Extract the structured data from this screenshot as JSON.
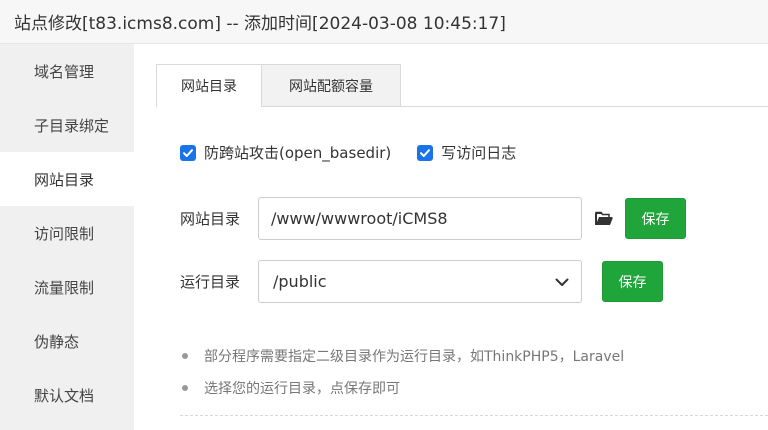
{
  "window": {
    "title": "站点修改[t83.icms8.com] -- 添加时间[2024-03-08 10:45:17]"
  },
  "sidebar": {
    "items": [
      {
        "label": "域名管理"
      },
      {
        "label": "子目录绑定"
      },
      {
        "label": "网站目录",
        "active": true
      },
      {
        "label": "访问限制"
      },
      {
        "label": "流量限制"
      },
      {
        "label": "伪静态"
      },
      {
        "label": "默认文档"
      }
    ]
  },
  "tabs": [
    {
      "label": "网站目录",
      "active": true
    },
    {
      "label": "网站配额容量",
      "active": false
    }
  ],
  "options": {
    "open_basedir": {
      "label": "防跨站攻击(open_basedir)",
      "checked": true
    },
    "access_log": {
      "label": "写访问日志",
      "checked": true
    }
  },
  "site_dir": {
    "label": "网站目录",
    "value": "/www/wwwroot/iCMS8",
    "save_label": "保存",
    "icon": "folder-open-icon"
  },
  "run_dir": {
    "label": "运行目录",
    "selected": "/public",
    "save_label": "保存"
  },
  "notes": [
    "部分程序需要指定二级目录作为运行目录，如ThinkPHP5，Laravel",
    "选择您的运行目录，点保存即可"
  ],
  "colors": {
    "accent": "#20a53a",
    "checkbox": "#1a73e8",
    "sidebar_bg": "#f0f0f0"
  }
}
